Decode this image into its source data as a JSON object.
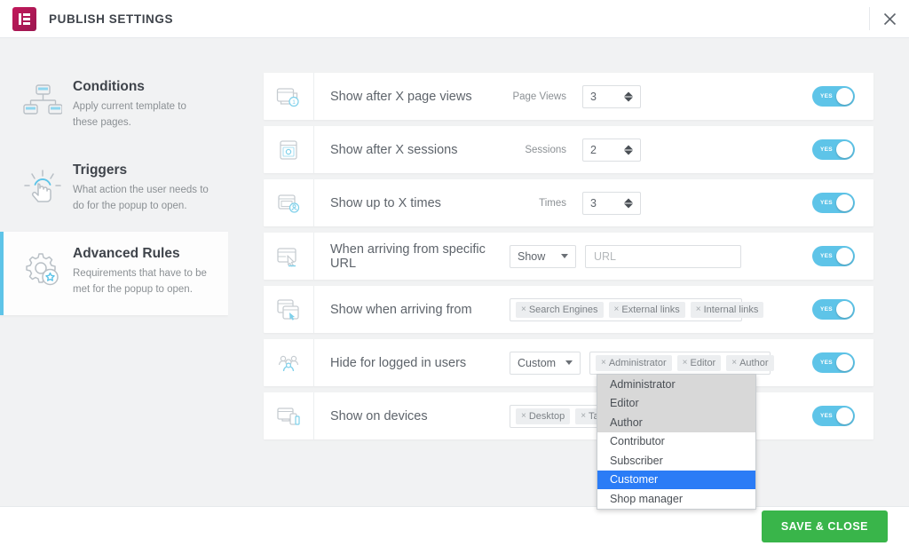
{
  "header": {
    "title": "PUBLISH SETTINGS",
    "logo_icon": "elementor-logo-icon",
    "close_icon": "close-icon",
    "brand_color": "#c2185b"
  },
  "sidebar": {
    "items": [
      {
        "icon": "sitemap-icon",
        "title": "Conditions",
        "desc": "Apply current template to these pages.",
        "active": false
      },
      {
        "icon": "tap-hand-icon",
        "title": "Triggers",
        "desc": "What action the user needs to do for the popup to open.",
        "active": false
      },
      {
        "icon": "gear-star-icon",
        "title": "Advanced Rules",
        "desc": "Requirements that have to be met for the popup to open.",
        "active": true
      }
    ],
    "active_accent": "#5ec4e8"
  },
  "main": {
    "rows": [
      {
        "icon": "page-views-icon",
        "label": "Show after X page views",
        "control_label": "Page Views",
        "control_type": "number",
        "value": "3",
        "toggle": "YES"
      },
      {
        "icon": "sessions-icon",
        "label": "Show after X sessions",
        "control_label": "Sessions",
        "control_type": "number",
        "value": "2",
        "toggle": "YES"
      },
      {
        "icon": "times-icon",
        "label": "Show up to X times",
        "control_label": "Times",
        "control_type": "number",
        "value": "3",
        "toggle": "YES"
      },
      {
        "icon": "arriving-url-icon",
        "label": "When arriving from specific URL",
        "control_label": "",
        "control_type": "select-and-text",
        "select_value": "Show",
        "text_placeholder": "URL",
        "text_value": "",
        "toggle": "YES"
      },
      {
        "icon": "arriving-from-icon",
        "label": "Show when arriving from",
        "control_label": "",
        "control_type": "tags",
        "tags": [
          "Search Engines",
          "External links",
          "Internal links"
        ],
        "toggle": "YES"
      },
      {
        "icon": "logged-in-users-icon",
        "label": "Hide for logged in users",
        "control_label": "",
        "control_type": "select-and-tags",
        "select_value": "Custom",
        "tags": [
          "Administrator",
          "Editor",
          "Author"
        ],
        "toggle": "YES"
      },
      {
        "icon": "devices-icon",
        "label": "Show on devices",
        "control_label": "",
        "control_type": "tags",
        "tags": [
          "Desktop",
          "Tablet"
        ],
        "toggle": "YES"
      }
    ],
    "toggle_on_color": "#5ec4e8"
  },
  "dropdown": {
    "chips": [
      "Administrator",
      "Editor",
      "Author"
    ],
    "options": [
      {
        "label": "Administrator",
        "state": "selected"
      },
      {
        "label": "Editor",
        "state": "selected"
      },
      {
        "label": "Author",
        "state": "selected"
      },
      {
        "label": "Contributor",
        "state": "normal"
      },
      {
        "label": "Subscriber",
        "state": "normal"
      },
      {
        "label": "Customer",
        "state": "highlighted"
      },
      {
        "label": "Shop manager",
        "state": "normal"
      }
    ],
    "highlight_color": "#2b7cf6"
  },
  "footer": {
    "save_label": "SAVE & CLOSE",
    "save_color": "#39b54a"
  }
}
